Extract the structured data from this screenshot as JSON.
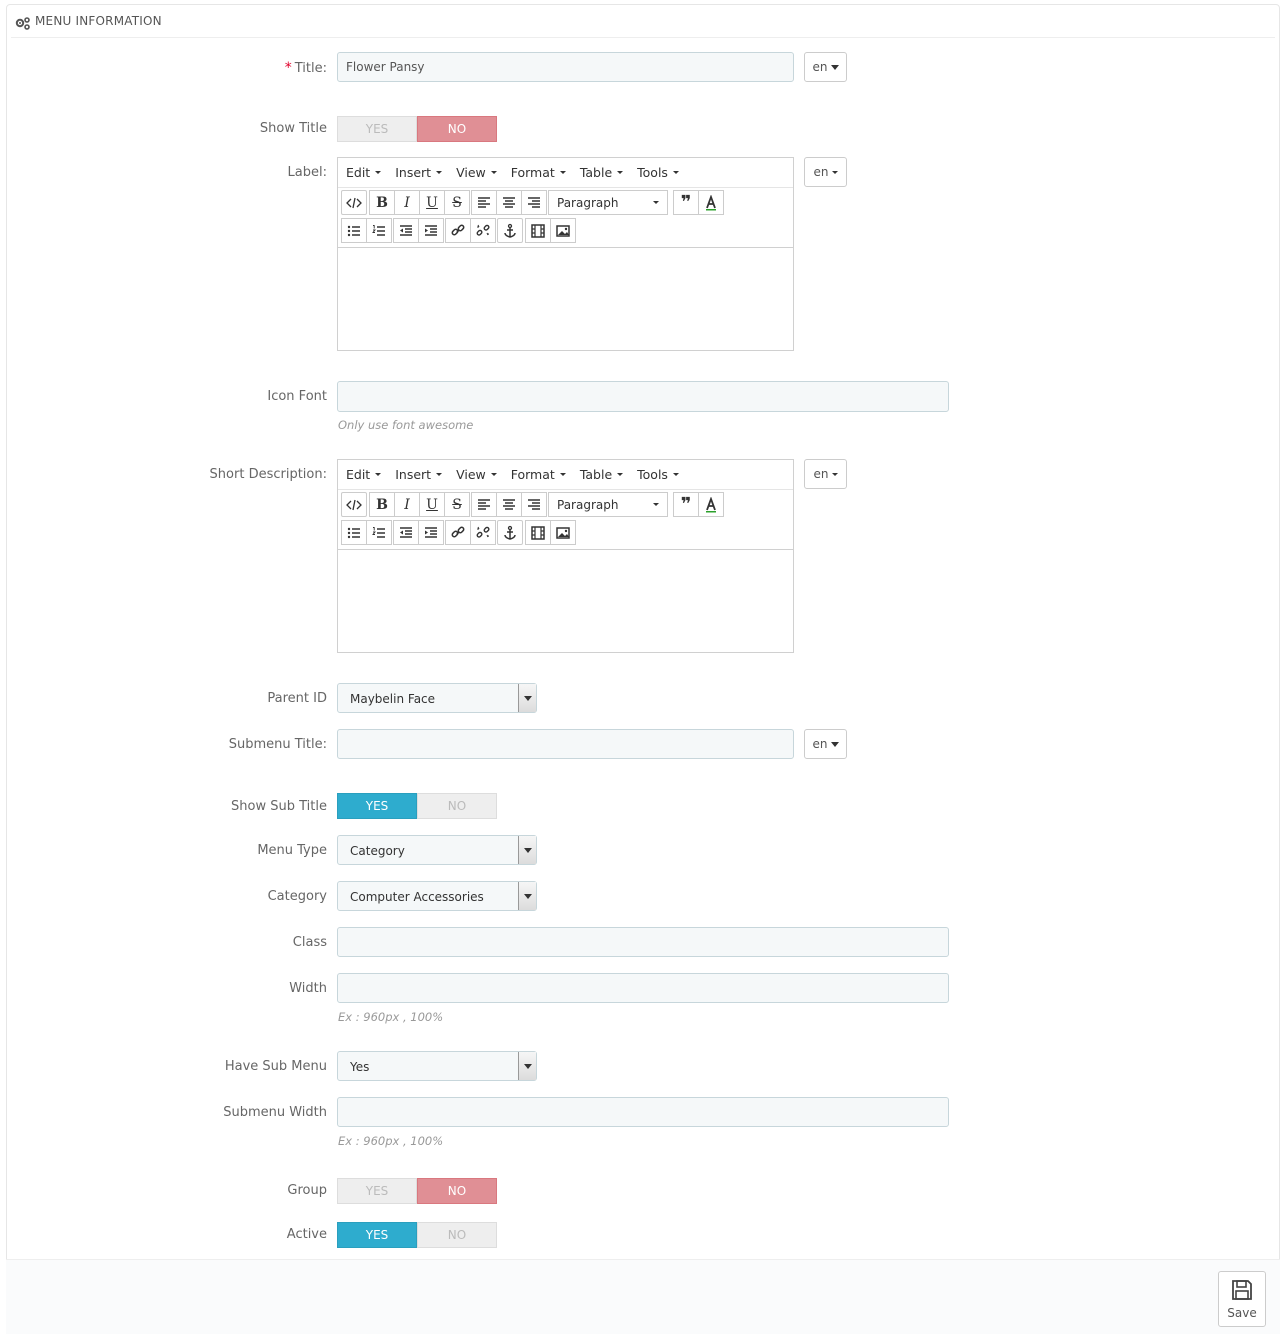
{
  "panel": {
    "title": "MENU INFORMATION",
    "icon": "gears-icon"
  },
  "fields": {
    "title": {
      "label": "Title:",
      "required_mark": "*",
      "value": "Flower Pansy",
      "lang": "en"
    },
    "show_title": {
      "label": "Show Title",
      "yes": "YES",
      "no": "NO",
      "selected": "NO"
    },
    "label": {
      "label": "Label:",
      "lang": "en"
    },
    "icon_font": {
      "label": "Icon Font",
      "value": "",
      "help": "Only use font awesome"
    },
    "short_description": {
      "label": "Short Description:",
      "lang": "en"
    },
    "parent_id": {
      "label": "Parent ID",
      "value": "Maybelin Face"
    },
    "submenu_title": {
      "label": "Submenu Title:",
      "value": "",
      "lang": "en"
    },
    "show_sub_title": {
      "label": "Show Sub Title",
      "yes": "YES",
      "no": "NO",
      "selected": "YES"
    },
    "menu_type": {
      "label": "Menu Type",
      "value": "Category"
    },
    "category": {
      "label": "Category",
      "value": "Computer Accessories"
    },
    "class": {
      "label": "Class",
      "value": ""
    },
    "width": {
      "label": "Width",
      "value": "",
      "help": "Ex : 960px , 100%"
    },
    "have_sub_menu": {
      "label": "Have Sub Menu",
      "value": "Yes"
    },
    "submenu_width": {
      "label": "Submenu Width",
      "value": "",
      "help": "Ex : 960px , 100%"
    },
    "group": {
      "label": "Group",
      "yes": "YES",
      "no": "NO",
      "selected": "NO"
    },
    "active": {
      "label": "Active",
      "yes": "YES",
      "no": "NO",
      "selected": "YES"
    }
  },
  "editor": {
    "menus": [
      "Edit",
      "Insert",
      "View",
      "Format",
      "Table",
      "Tools"
    ],
    "block_format": "Paragraph",
    "toolbar_row1": [
      "source-code-icon",
      "bold-icon",
      "italic-icon",
      "underline-icon",
      "strikethrough-icon",
      "align-left-icon",
      "align-center-icon",
      "align-right-icon",
      "blockquote-icon",
      "text-color-icon"
    ],
    "toolbar_row2": [
      "bullet-list-icon",
      "numbered-list-icon",
      "outdent-icon",
      "indent-icon",
      "link-icon",
      "unlink-icon",
      "anchor-icon",
      "media-icon",
      "image-icon"
    ]
  },
  "footer": {
    "save_label": "Save",
    "save_icon": "floppy-disk-icon"
  },
  "colors": {
    "yes_active": "#2eacce",
    "no_active": "#e08f95",
    "input_bg": "#f5f8f9"
  }
}
